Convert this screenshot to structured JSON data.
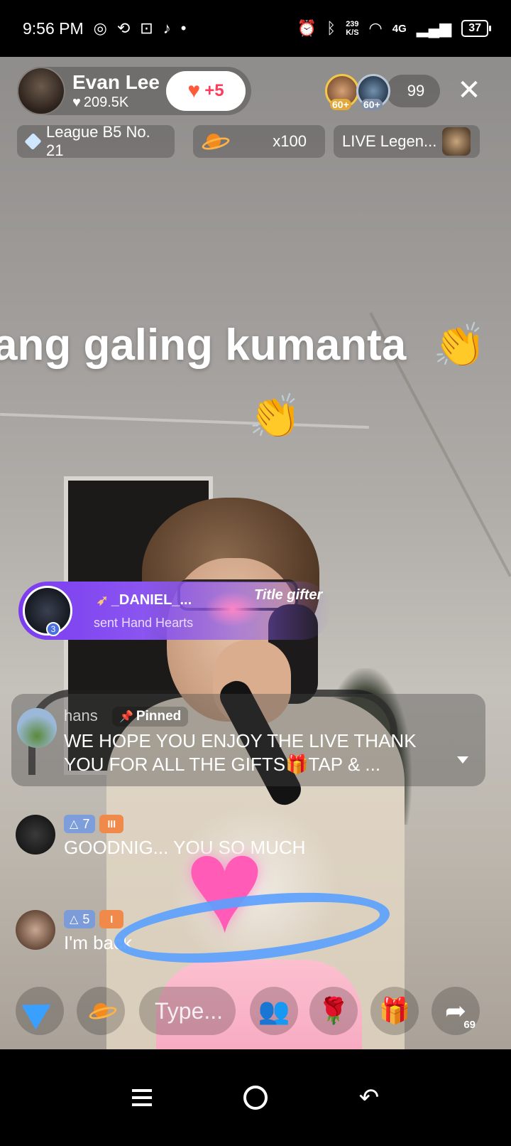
{
  "status_bar": {
    "time": "9:56 PM",
    "net_speed": "239",
    "net_unit": "K/S",
    "network": "4G",
    "battery": "37"
  },
  "host": {
    "name": "Evan Lee",
    "likes": "209.5K",
    "follow_count": "+5"
  },
  "viewers": {
    "badge1": "60+",
    "badge2": "60+",
    "count": "99"
  },
  "chips": {
    "league": "League B5 No. 21",
    "boost": "x100",
    "legend": "LIVE Legen..."
  },
  "caption": {
    "text": "ang galing kumanta"
  },
  "gift_banner": {
    "user": "_DANIEL_...",
    "text": "sent Hand Hearts",
    "avatar_level": "3",
    "title": "Title gifter"
  },
  "pinned": {
    "user": "hans",
    "tag": "Pinned",
    "text": "WE HOPE YOU ENJOY THE LIVE THANK YOU FOR ALL THE GIFTS🎁TAP & ..."
  },
  "comments": [
    {
      "level": "7",
      "fan": "lll",
      "text": "GOODNIG... YOU SO MUCH"
    },
    {
      "level": "5",
      "fan": "l",
      "text": "I'm back"
    }
  ],
  "bottom_bar": {
    "input_placeholder": "Type...",
    "share_count": "69"
  },
  "colors": {
    "accent_follow": "#ff3b5c",
    "gift_banner": "#7b3cf0",
    "send_icon": "#3aa0ff"
  }
}
